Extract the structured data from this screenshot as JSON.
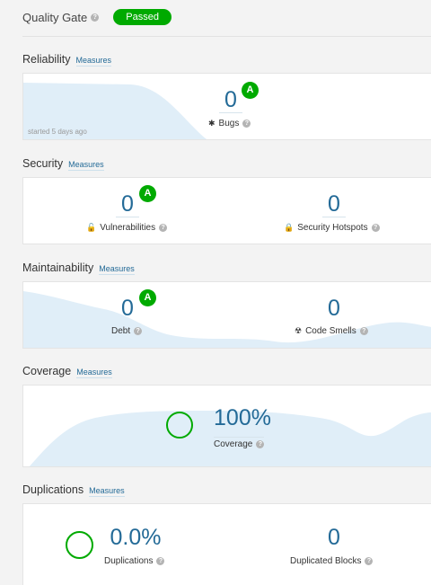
{
  "quality_gate": {
    "title": "Quality Gate",
    "status": "Passed",
    "status_color": "#00aa00"
  },
  "help_glyph": "?",
  "measures_label": "Measures",
  "reliability": {
    "title": "Reliability",
    "bugs": {
      "value": "0",
      "label": "Bugs",
      "rating": "A"
    },
    "started": "started 5 days ago"
  },
  "security": {
    "title": "Security",
    "vulnerabilities": {
      "value": "0",
      "label": "Vulnerabilities",
      "rating": "A"
    },
    "hotspots": {
      "value": "0",
      "label": "Security Hotspots"
    }
  },
  "maintainability": {
    "title": "Maintainability",
    "debt": {
      "value": "0",
      "label": "Debt",
      "rating": "A"
    },
    "code_smells": {
      "value": "0",
      "label": "Code Smells"
    }
  },
  "coverage": {
    "title": "Coverage",
    "coverage": {
      "value": "100%",
      "label": "Coverage",
      "fraction": 1.0
    }
  },
  "duplications": {
    "title": "Duplications",
    "duplications": {
      "value": "0.0%",
      "label": "Duplications",
      "fraction": 0.0
    },
    "blocks": {
      "value": "0",
      "label": "Duplicated Blocks"
    }
  },
  "colors": {
    "link": "#236a97",
    "good": "#00aa00",
    "area": "#e0eef8"
  },
  "icons": {
    "bugs": "bug-icon",
    "vulnerabilities": "lock-icon",
    "hotspots": "lock-icon",
    "code_smells": "nuclear-icon"
  }
}
